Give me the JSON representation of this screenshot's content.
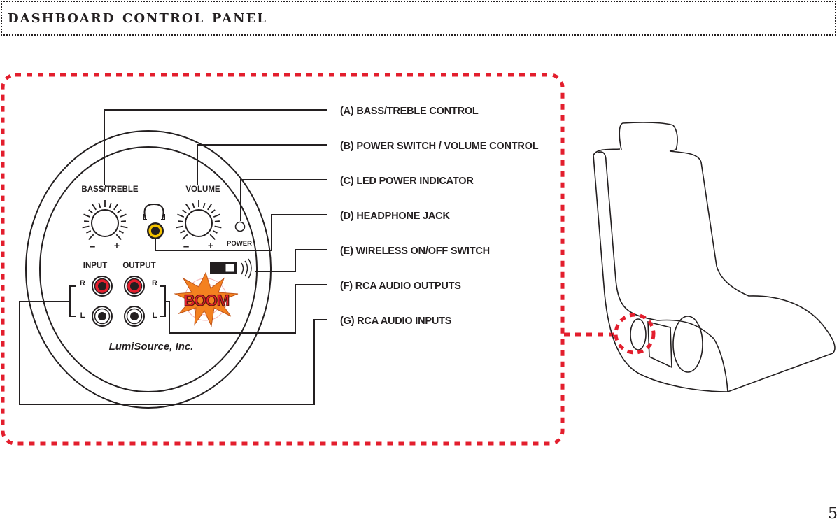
{
  "page": {
    "title": "DASHBOARD CONTROL PANEL",
    "page_number": "5"
  },
  "panel": {
    "labels": {
      "bass_treble": "BASS/TREBLE",
      "volume": "VOLUME",
      "power": "POWER",
      "input": "INPUT",
      "output": "OUTPUT",
      "right": "R",
      "left": "L",
      "minus": "–",
      "plus": "+"
    },
    "brand": "LumiSource, Inc.",
    "logo_text": "BOOM",
    "colors": {
      "accent_red": "#e31e2d",
      "headphone_yellow": "#f5c400",
      "boom_orange": "#f48120",
      "line": "#231f20"
    }
  },
  "legend": [
    {
      "key": "A",
      "text": "(A)  BASS/TREBLE CONTROL"
    },
    {
      "key": "B",
      "text": "(B)  POWER SWITCH / VOLUME CONTROL"
    },
    {
      "key": "C",
      "text": "(C)  LED POWER INDICATOR"
    },
    {
      "key": "D",
      "text": "(D)  HEADPHONE JACK"
    },
    {
      "key": "E",
      "text": "(E)  WIRELESS ON/OFF SWITCH"
    },
    {
      "key": "F",
      "text": "(F)  RCA AUDIO OUTPUTS"
    },
    {
      "key": "G",
      "text": "(G) RCA AUDIO INPUTS"
    }
  ]
}
